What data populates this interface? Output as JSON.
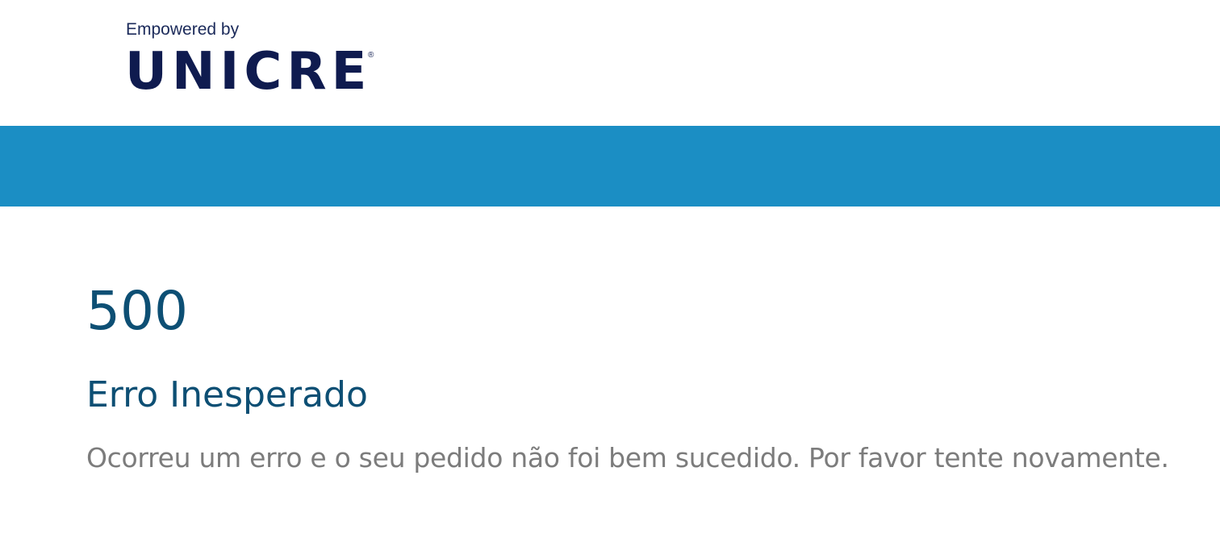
{
  "header": {
    "logo": {
      "tagline": "Empowered by",
      "brand": "UNICRE",
      "registered_mark": "®"
    }
  },
  "error": {
    "code": "500",
    "title": "Erro Inesperado",
    "message": "Ocorreu um erro e o seu pedido não foi bem sucedido. Por favor tente novamente."
  },
  "colors": {
    "brand_navy": "#0f1b4f",
    "band_blue": "#1b8ec4",
    "heading_blue": "#0d4f74",
    "body_gray": "#7c7c7c"
  }
}
